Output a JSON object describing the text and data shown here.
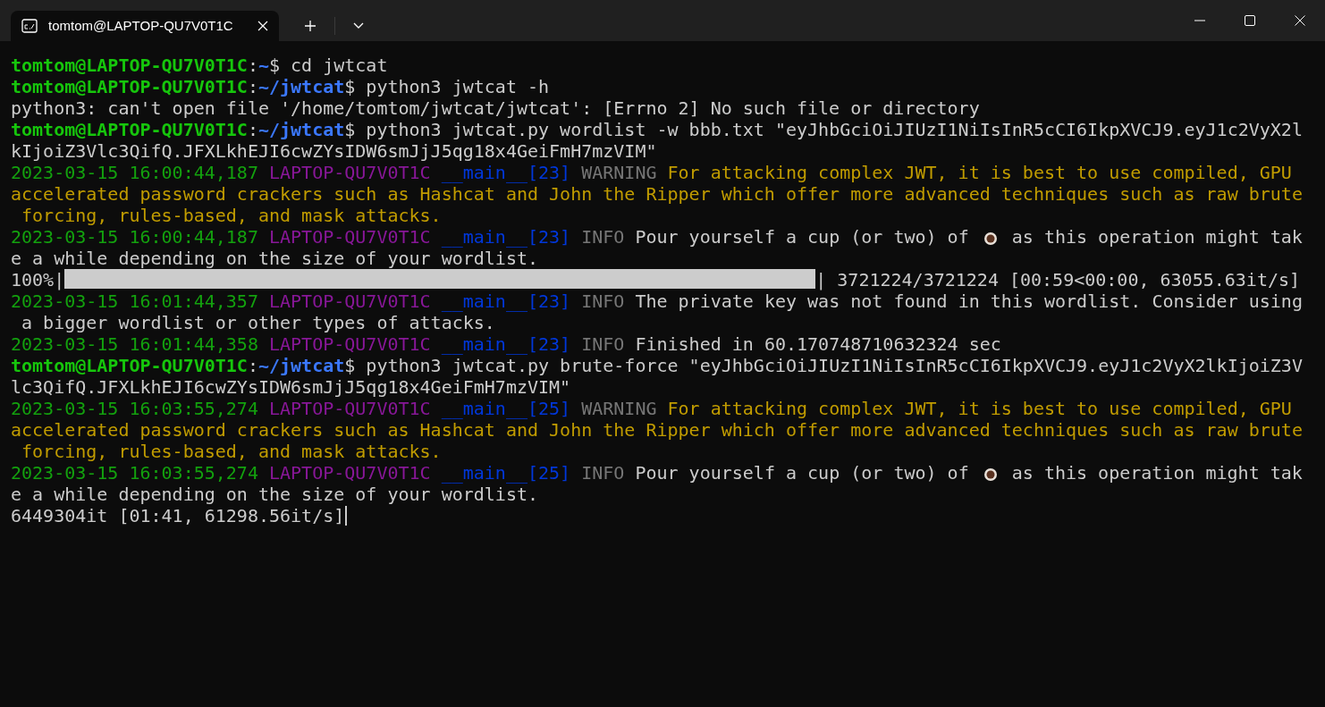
{
  "tab": {
    "title": "tomtom@LAPTOP-QU7V0T1C",
    "selected": true
  },
  "lines": [
    [
      {
        "kind": "user",
        "text": "tomtom@LAPTOP-QU7V0T1C"
      },
      {
        "kind": "plain",
        "text": ":"
      },
      {
        "kind": "path",
        "text": "~"
      },
      {
        "kind": "plain",
        "text": "$ cd jwtcat"
      }
    ],
    [
      {
        "kind": "user",
        "text": "tomtom@LAPTOP-QU7V0T1C"
      },
      {
        "kind": "plain",
        "text": ":"
      },
      {
        "kind": "path",
        "text": "~/jwtcat"
      },
      {
        "kind": "plain",
        "text": "$ python3 jwtcat -h"
      }
    ],
    [
      {
        "kind": "plain",
        "text": "python3: can't open file '/home/tomtom/jwtcat/jwtcat': [Errno 2] No such file or directory"
      }
    ],
    [
      {
        "kind": "user",
        "text": "tomtom@LAPTOP-QU7V0T1C"
      },
      {
        "kind": "plain",
        "text": ":"
      },
      {
        "kind": "path",
        "text": "~/jwtcat"
      },
      {
        "kind": "plain",
        "text": "$ python3 jwtcat.py wordlist -w bbb.txt \"eyJhbGciOiJIUzI1NiIsInR5cCI6IkpXVCJ9.eyJ1c2VyX2l"
      }
    ],
    [
      {
        "kind": "plain",
        "text": "kIjoiZ3Vlc3QifQ.JFXLkhEJI6cwZYsIDW6smJjJ5qg18x4GeiFmH7mzVIM\""
      }
    ],
    [
      {
        "kind": "time",
        "text": "2023-03-15 16:00:44,187 "
      },
      {
        "kind": "host",
        "text": "LAPTOP-QU7V0T1C "
      },
      {
        "kind": "module",
        "text": "__main__[23] "
      },
      {
        "kind": "level",
        "text": "WARNING "
      },
      {
        "kind": "warn",
        "text": "For attacking complex JWT, it is best to use compiled, GPU"
      }
    ],
    [
      {
        "kind": "warn",
        "text": "accelerated password crackers such as Hashcat and John the Ripper which offer more advanced techniques such as raw brute"
      }
    ],
    [
      {
        "kind": "warn",
        "text": " forcing, rules-based, and mask attacks."
      }
    ],
    [
      {
        "kind": "time",
        "text": "2023-03-15 16:00:44,187 "
      },
      {
        "kind": "host",
        "text": "LAPTOP-QU7V0T1C "
      },
      {
        "kind": "module",
        "text": "__main__[23] "
      },
      {
        "kind": "level",
        "text": "INFO "
      },
      {
        "kind": "plain",
        "text": "Pour yourself a cup (or two) of "
      },
      {
        "kind": "cup"
      },
      {
        "kind": "plain",
        "text": " as this operation might tak"
      }
    ],
    [
      {
        "kind": "plain",
        "text": "e a while depending on the size of your wordlist."
      }
    ],
    [
      {
        "kind": "plain",
        "text": "100%|"
      },
      {
        "kind": "bar",
        "level": 1
      },
      {
        "kind": "plain",
        "text": "| 3721224/3721224 [00:59<00:00, 63055.63it/s]"
      }
    ],
    [
      {
        "kind": "time",
        "text": "2023-03-15 16:01:44,357 "
      },
      {
        "kind": "host",
        "text": "LAPTOP-QU7V0T1C "
      },
      {
        "kind": "module",
        "text": "__main__[23] "
      },
      {
        "kind": "level",
        "text": "INFO "
      },
      {
        "kind": "plain",
        "text": "The private key was not found in this wordlist. Consider using"
      }
    ],
    [
      {
        "kind": "plain",
        "text": " a bigger wordlist or other types of attacks."
      }
    ],
    [
      {
        "kind": "time",
        "text": "2023-03-15 16:01:44,358 "
      },
      {
        "kind": "host",
        "text": "LAPTOP-QU7V0T1C "
      },
      {
        "kind": "module",
        "text": "__main__[23] "
      },
      {
        "kind": "level",
        "text": "INFO "
      },
      {
        "kind": "plain",
        "text": "Finished in 60.170748710632324 sec"
      }
    ],
    [
      {
        "kind": "user",
        "text": "tomtom@LAPTOP-QU7V0T1C"
      },
      {
        "kind": "plain",
        "text": ":"
      },
      {
        "kind": "path",
        "text": "~/jwtcat"
      },
      {
        "kind": "plain",
        "text": "$ python3 jwtcat.py brute-force \"eyJhbGciOiJIUzI1NiIsInR5cCI6IkpXVCJ9.eyJ1c2VyX2lkIjoiZ3V"
      }
    ],
    [
      {
        "kind": "plain",
        "text": "lc3QifQ.JFXLkhEJI6cwZYsIDW6smJjJ5qg18x4GeiFmH7mzVIM\""
      }
    ],
    [
      {
        "kind": "time",
        "text": "2023-03-15 16:03:55,274 "
      },
      {
        "kind": "host",
        "text": "LAPTOP-QU7V0T1C "
      },
      {
        "kind": "module",
        "text": "__main__[25] "
      },
      {
        "kind": "level",
        "text": "WARNING "
      },
      {
        "kind": "warn",
        "text": "For attacking complex JWT, it is best to use compiled, GPU"
      }
    ],
    [
      {
        "kind": "warn",
        "text": "accelerated password crackers such as Hashcat and John the Ripper which offer more advanced techniques such as raw brute"
      }
    ],
    [
      {
        "kind": "warn",
        "text": " forcing, rules-based, and mask attacks."
      }
    ],
    [
      {
        "kind": "time",
        "text": "2023-03-15 16:03:55,274 "
      },
      {
        "kind": "host",
        "text": "LAPTOP-QU7V0T1C "
      },
      {
        "kind": "module",
        "text": "__main__[25] "
      },
      {
        "kind": "level",
        "text": "INFO "
      },
      {
        "kind": "plain",
        "text": "Pour yourself a cup (or two) of "
      },
      {
        "kind": "cup"
      },
      {
        "kind": "plain",
        "text": " as this operation might tak"
      }
    ],
    [
      {
        "kind": "plain",
        "text": "e a while depending on the size of your wordlist."
      }
    ],
    [
      {
        "kind": "plain",
        "text": "6449304it [01:41, 61298.56it/s]"
      },
      {
        "kind": "cursor"
      }
    ]
  ]
}
